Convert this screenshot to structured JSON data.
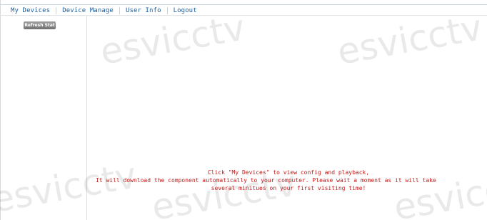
{
  "nav": {
    "items": [
      "My Devices",
      "Device Manage",
      "User Info",
      "Logout"
    ]
  },
  "sidebar": {
    "refresh_label": "Refresh Stat"
  },
  "watermark": {
    "text": "esvicctv"
  },
  "message": {
    "line1": "Click \"My Devices\" to view config and playback,",
    "line2": "It will download the component automatically to your computer. Please wait a moment as it will take",
    "line3": "several minitues on your first visiting time!"
  },
  "colors": {
    "nav_text": "#1b5b9e",
    "message_text": "#c41717",
    "button_fill": "#8a8a8a"
  }
}
